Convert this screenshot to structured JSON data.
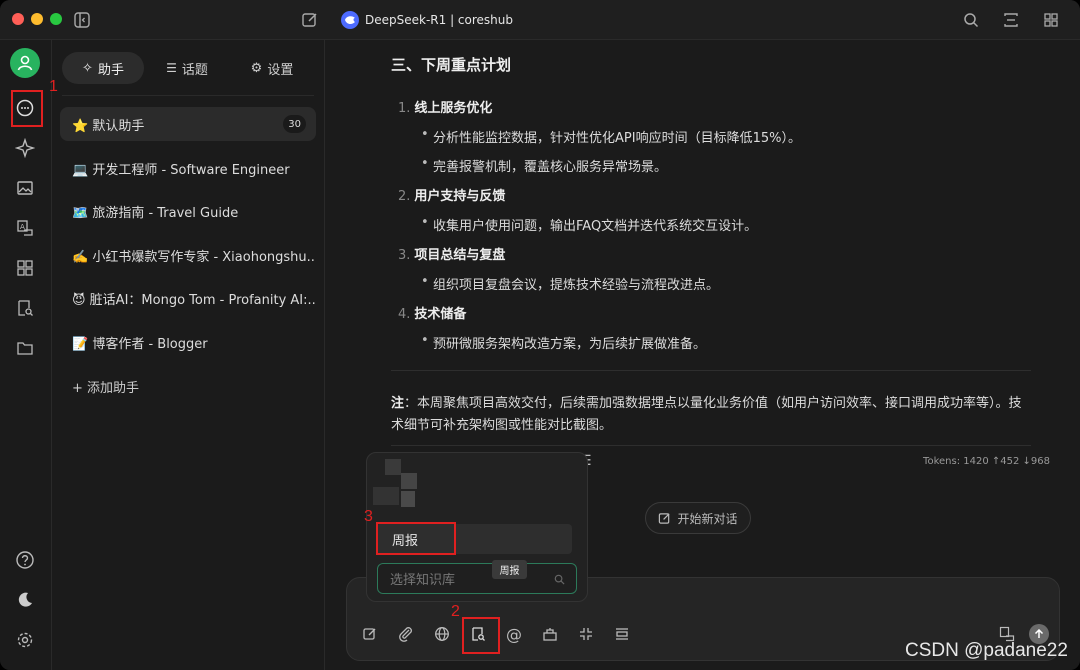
{
  "window": {
    "model_title": "DeepSeek-R1 | coreshub",
    "traffic_colors": [
      "#ff5f57",
      "#febc2e",
      "#28c840"
    ]
  },
  "sidebar": {
    "tabs": [
      {
        "label": "助手",
        "icon": "sparkle-icon"
      },
      {
        "label": "话题",
        "icon": "list-icon"
      },
      {
        "label": "设置",
        "icon": "gear-icon"
      }
    ],
    "assistants": [
      {
        "label": "⭐ 默认助手",
        "count": "30"
      },
      {
        "label": "💻 开发工程师 - Software Engineer"
      },
      {
        "label": "🗺️ 旅游指南 - Travel Guide"
      },
      {
        "label": "✍️ 小红书爆款写作专家 - Xiaohongshu..."
      },
      {
        "label": "😈 脏话AI：Mongo Tom - Profanity AI:..."
      },
      {
        "label": "📝 博客作者 - Blogger"
      }
    ],
    "add_label": "+ 添加助手"
  },
  "message": {
    "heading": "三、下周重点计划",
    "items": [
      {
        "num": "1.",
        "title": "线上服务优化",
        "bullets": [
          "分析性能监控数据，针对性优化API响应时间（目标降低15%）。",
          "完善报警机制，覆盖核心服务异常场景。"
        ]
      },
      {
        "num": "2.",
        "title": "用户支持与反馈",
        "bullets": [
          "收集用户使用问题，输出FAQ文档并迭代系统交互设计。"
        ]
      },
      {
        "num": "3.",
        "title": "项目总结与复盘",
        "bullets": [
          "组织项目复盘会议，提炼技术经验与流程改进点。"
        ]
      },
      {
        "num": "4.",
        "title": "技术储备",
        "bullets": [
          "预研微服务架构改造方案，为后续扩展做准备。"
        ]
      }
    ],
    "note_label": "注",
    "note_text": "：本周聚焦项目高效交付，后续需加强数据埋点以量化业务价值（如用户访问效率、接口调用成功率等）。技术细节可补充架构图或性能对比截图。",
    "tokens": "Tokens: 1420 ↑452 ↓968"
  },
  "new_chat": "开始新对话",
  "knowledge": {
    "item": "周报",
    "search_placeholder": "选择知识库",
    "tooltip": "周报"
  },
  "annotations": {
    "n1": "1",
    "n2": "2",
    "n3": "3"
  },
  "watermark": "CSDN @padane22",
  "colors": {
    "accent_green": "#28b35f",
    "highlight_red": "#e02020",
    "deepseek_blue": "#4d6bfe"
  }
}
